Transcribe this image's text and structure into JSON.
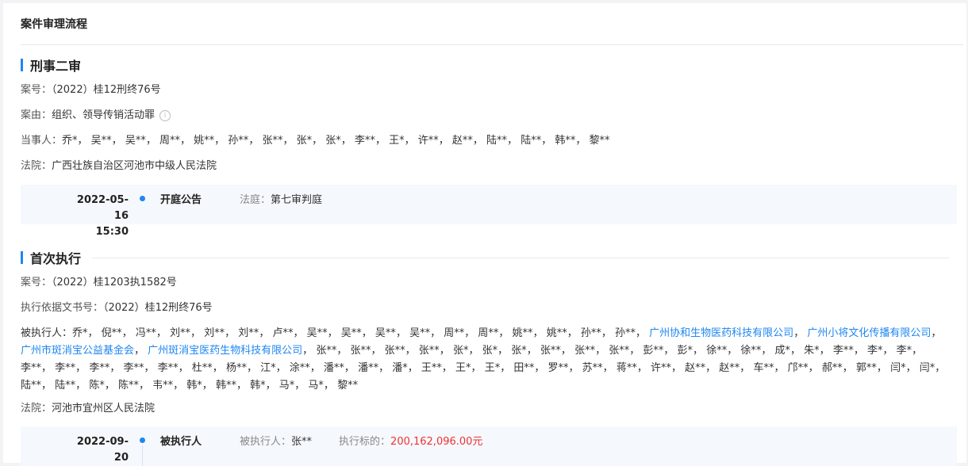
{
  "panel_title": "案件审理流程",
  "section1": {
    "title": "刑事二审",
    "case_no_label": "案号：",
    "case_no": "（2022）桂12刑终76号",
    "cause_label": "案由：",
    "cause": "组织、领导传销活动罪",
    "info_icon": "i",
    "parties_label": "当事人：",
    "parties": [
      "乔*",
      "吴**",
      "吴**",
      "周**",
      "姚**",
      "孙**",
      "张**",
      "张*",
      "张*",
      "李**",
      "王*",
      "许**",
      "赵**",
      "陆**",
      "陆**",
      "韩**",
      "黎**"
    ],
    "court_label": "法院：",
    "court": "广西壮族自治区河池市中级人民法院",
    "timeline": {
      "date": "2022-05-16",
      "time": "15:30",
      "type": "开庭公告",
      "detail_label": "法庭：",
      "detail": "第七审判庭"
    }
  },
  "section2": {
    "title": "首次执行",
    "case_no_label": "案号：",
    "case_no": "（2022）桂1203执1582号",
    "basis_label": "执行依据文书号：",
    "basis": "（2022）桂12刑终76号",
    "executed_label": "被执行人：",
    "executed": [
      {
        "name": "乔*"
      },
      {
        "name": "倪**"
      },
      {
        "name": "冯**"
      },
      {
        "name": "刘**"
      },
      {
        "name": "刘**"
      },
      {
        "name": "刘**"
      },
      {
        "name": "卢**"
      },
      {
        "name": "吴**"
      },
      {
        "name": "吴**"
      },
      {
        "name": "吴**"
      },
      {
        "name": "吴**"
      },
      {
        "name": "周**"
      },
      {
        "name": "周**"
      },
      {
        "name": "姚**"
      },
      {
        "name": "姚**"
      },
      {
        "name": "孙**"
      },
      {
        "name": "孙**"
      },
      {
        "name": "广州协和生物医药科技有限公司",
        "link": true
      },
      {
        "name": "广州小将文化传播有限公司",
        "link": true
      },
      {
        "name": "广州市斑消宝公益基金会",
        "link": true
      },
      {
        "name": "广州斑消宝医药生物科技有限公司",
        "link": true
      },
      {
        "name": "张**"
      },
      {
        "name": "张**"
      },
      {
        "name": "张**"
      },
      {
        "name": "张**"
      },
      {
        "name": "张*"
      },
      {
        "name": "张*"
      },
      {
        "name": "张*"
      },
      {
        "name": "张**"
      },
      {
        "name": "张**"
      },
      {
        "name": "张**"
      },
      {
        "name": "彭**"
      },
      {
        "name": "彭*"
      },
      {
        "name": "徐**"
      },
      {
        "name": "徐**"
      },
      {
        "name": "成*"
      },
      {
        "name": "朱*"
      },
      {
        "name": "李**"
      },
      {
        "name": "李*"
      },
      {
        "name": "李*"
      },
      {
        "name": "李**"
      },
      {
        "name": "李**"
      },
      {
        "name": "李**"
      },
      {
        "name": "李**"
      },
      {
        "name": "李**"
      },
      {
        "name": "杜**"
      },
      {
        "name": "杨**"
      },
      {
        "name": "江*"
      },
      {
        "name": "涂**"
      },
      {
        "name": "潘**"
      },
      {
        "name": "潘**"
      },
      {
        "name": "潘*"
      },
      {
        "name": "王**"
      },
      {
        "name": "王*"
      },
      {
        "name": "王*"
      },
      {
        "name": "田**"
      },
      {
        "name": "罗**"
      },
      {
        "name": "苏**"
      },
      {
        "name": "蒋**"
      },
      {
        "name": "许**"
      },
      {
        "name": "赵**"
      },
      {
        "name": "赵**"
      },
      {
        "name": "车**"
      },
      {
        "name": "邝**"
      },
      {
        "name": "郝**"
      },
      {
        "name": "郭**"
      },
      {
        "name": "闫*"
      },
      {
        "name": "闫*"
      },
      {
        "name": "陆**"
      },
      {
        "name": "陆**"
      },
      {
        "name": "陈*"
      },
      {
        "name": "陈**"
      },
      {
        "name": "韦**"
      },
      {
        "name": "韩*"
      },
      {
        "name": "韩**"
      },
      {
        "name": "韩*"
      },
      {
        "name": "马*"
      },
      {
        "name": "马*"
      },
      {
        "name": "黎**"
      }
    ],
    "court_label": "法院：",
    "court": "河池市宜州区人民法院",
    "timeline": {
      "date": "2022-09-20",
      "type": "被执行人",
      "detail_label": "被执行人：",
      "detail": "张**",
      "amount_label": "执行标的：",
      "amount": "200,162,096.00元"
    }
  }
}
